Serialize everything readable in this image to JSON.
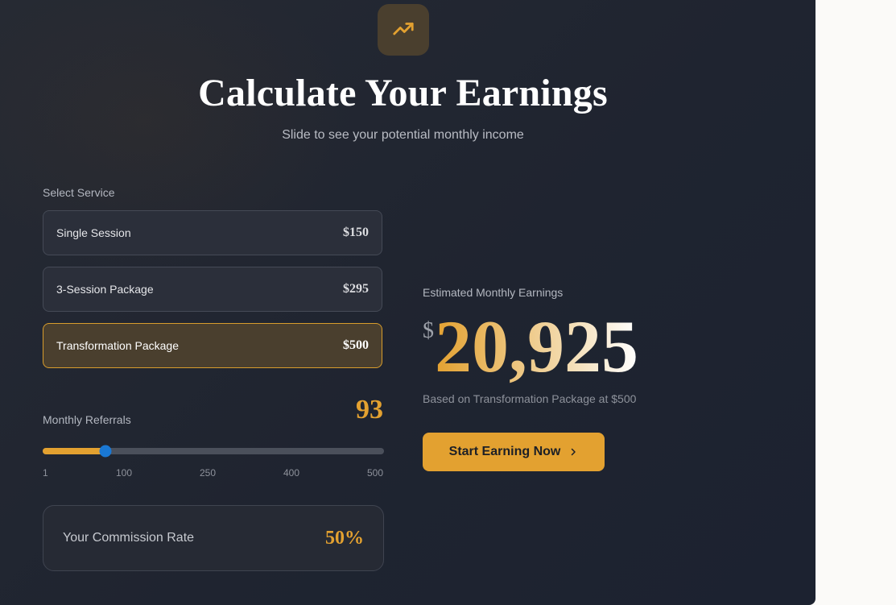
{
  "colors": {
    "accent": "#e3a130",
    "card_background": "#1f2430",
    "selected_background": "#4a3f2e",
    "slider_thumb": "#1a78d4"
  },
  "header": {
    "icon": "trending-up-icon",
    "title": "Calculate Your Earnings",
    "subtitle": "Slide to see your potential monthly income"
  },
  "services": {
    "label": "Select Service",
    "items": [
      {
        "name": "Single Session",
        "price": "$150",
        "selected": false
      },
      {
        "name": "3-Session Package",
        "price": "$295",
        "selected": false
      },
      {
        "name": "Transformation Package",
        "price": "$500",
        "selected": true
      }
    ]
  },
  "referrals": {
    "label": "Monthly Referrals",
    "value": "93",
    "slider": {
      "min": 1,
      "max": 500,
      "current": 93,
      "ticks": [
        "1",
        "100",
        "250",
        "400",
        "500"
      ]
    }
  },
  "commission": {
    "label": "Your Commission Rate",
    "value": "50%"
  },
  "earnings": {
    "label": "Estimated Monthly Earnings",
    "currency": "$",
    "amount": "20,925",
    "basis": "Based on Transformation Package at $500"
  },
  "cta": {
    "label": "Start Earning Now",
    "icon": "chevron-right-icon"
  }
}
